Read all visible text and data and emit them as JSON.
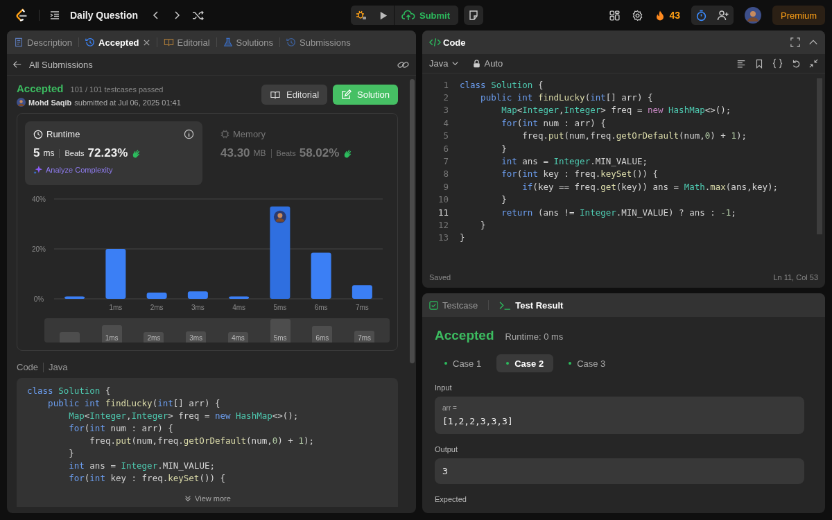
{
  "topbar": {
    "title": "Daily Question",
    "submit": "Submit",
    "streak": "43",
    "premium": "Premium"
  },
  "left_tabs": [
    {
      "label": "Description",
      "selected": false,
      "closable": false
    },
    {
      "label": "Accepted",
      "selected": true,
      "closable": true
    },
    {
      "label": "Editorial",
      "selected": false,
      "closable": false
    },
    {
      "label": "Solutions",
      "selected": false,
      "closable": false
    },
    {
      "label": "Submissions",
      "selected": false,
      "closable": false
    }
  ],
  "back_link": "All Submissions",
  "submission": {
    "status": "Accepted",
    "passed": "101 / 101 testcases passed",
    "user": "Mohd Saqib",
    "submitted": "submitted at Jul 06, 2025 01:41",
    "buttons": [
      {
        "label": "Editorial",
        "kind": "secondary"
      },
      {
        "label": "Solution",
        "kind": "primary"
      }
    ]
  },
  "stats": [
    {
      "title": "Runtime",
      "value": "5",
      "unit": "ms",
      "beats_label": "Beats",
      "beats": "72.23%",
      "selected": true,
      "link": "Analyze Complexity"
    },
    {
      "title": "Memory",
      "value": "43.30",
      "unit": "MB",
      "beats_label": "Beats",
      "beats": "58.02%",
      "selected": false
    }
  ],
  "chart_data": {
    "type": "bar",
    "categories": [
      null,
      "1ms",
      "2ms",
      "3ms",
      "4ms",
      "5ms",
      "6ms",
      "7ms"
    ],
    "values": [
      1,
      20,
      2.5,
      3,
      1,
      37,
      18.5,
      5.5
    ],
    "ylim": [
      0,
      40
    ],
    "yticks": [
      {
        "value": 0,
        "label": "0%"
      },
      {
        "value": 20,
        "label": "20%"
      },
      {
        "value": 40,
        "label": "40%"
      }
    ]
  },
  "chart_bars": [
    {
      "selected": false
    },
    {
      "selected": false
    },
    {
      "selected": false
    },
    {
      "selected": false
    },
    {
      "selected": false
    },
    {
      "selected": true
    },
    {
      "selected": false
    },
    {
      "selected": false
    }
  ],
  "range_selector": {
    "labels": [
      "1ms",
      "2ms",
      "3ms",
      "4ms",
      "5ms",
      "6ms",
      "7ms"
    ]
  },
  "code_section": {
    "label": "Code",
    "language": "Java",
    "view_more": "View more",
    "lines": [
      [
        {
          "kind": "kw",
          "text": "class"
        },
        {
          "kind": "type",
          "text": " Solution"
        },
        {
          "kind": "p",
          "text": " {"
        }
      ],
      [
        {
          "kind": "kw",
          "text": "    public int"
        },
        {
          "kind": "fn",
          "text": " findLucky"
        },
        {
          "kind": "p",
          "text": "("
        },
        {
          "kind": "kw",
          "text": "int"
        },
        {
          "kind": "p",
          "text": "[] arr) {"
        }
      ],
      [
        {
          "kind": "type",
          "text": "        Map"
        },
        {
          "kind": "p",
          "text": "<"
        },
        {
          "kind": "type",
          "text": "Integer"
        },
        {
          "kind": "p",
          "text": ","
        },
        {
          "kind": "type",
          "text": "Integer"
        },
        {
          "kind": "p",
          "text": "> freq = "
        },
        {
          "kind": "kw",
          "text": "new"
        },
        {
          "kind": "type",
          "text": " HashMap"
        },
        {
          "kind": "p",
          "text": "<>();"
        }
      ],
      [
        {
          "kind": "kw",
          "text": "        for"
        },
        {
          "kind": "p",
          "text": "("
        },
        {
          "kind": "kw",
          "text": "int"
        },
        {
          "kind": "p",
          "text": " num : arr) {"
        }
      ],
      [
        {
          "kind": "p",
          "text": "            freq."
        },
        {
          "kind": "fn",
          "text": "put"
        },
        {
          "kind": "p",
          "text": "(num,freq."
        },
        {
          "kind": "fn",
          "text": "getOrDefault"
        },
        {
          "kind": "p",
          "text": "(num,"
        },
        {
          "kind": "num",
          "text": "0"
        },
        {
          "kind": "p",
          "text": ") + "
        },
        {
          "kind": "num",
          "text": "1"
        },
        {
          "kind": "p",
          "text": ");"
        }
      ],
      [
        {
          "kind": "p",
          "text": "        }"
        }
      ],
      [
        {
          "kind": "kw",
          "text": "        int"
        },
        {
          "kind": "p",
          "text": " ans = "
        },
        {
          "kind": "type",
          "text": "Integer"
        },
        {
          "kind": "p",
          "text": ".MIN_VALUE;"
        }
      ],
      [
        {
          "kind": "kw",
          "text": "        for"
        },
        {
          "kind": "p",
          "text": "("
        },
        {
          "kind": "kw",
          "text": "int"
        },
        {
          "kind": "p",
          "text": " key : freq."
        },
        {
          "kind": "fn",
          "text": "keySet"
        },
        {
          "kind": "p",
          "text": "()) {"
        }
      ]
    ]
  },
  "editor": {
    "title": "Code",
    "language": "Java",
    "mode": "Auto",
    "status": "Saved",
    "cursor": "Ln 11, Col 53",
    "lines": [
      {
        "n": "1",
        "selected": false,
        "tokens": [
          {
            "kind": "kw",
            "text": "class"
          },
          {
            "kind": "type",
            "text": " Solution"
          },
          {
            "kind": "p",
            "text": " {"
          }
        ]
      },
      {
        "n": "2",
        "selected": false,
        "tokens": [
          {
            "kind": "kw",
            "text": "    public int"
          },
          {
            "kind": "fn",
            "text": " findLucky"
          },
          {
            "kind": "p",
            "text": "("
          },
          {
            "kind": "kw",
            "text": "int"
          },
          {
            "kind": "p",
            "text": "[] arr) {"
          }
        ]
      },
      {
        "n": "3",
        "selected": false,
        "tokens": [
          {
            "kind": "type",
            "text": "        Map"
          },
          {
            "kind": "p",
            "text": "<"
          },
          {
            "kind": "type",
            "text": "Integer"
          },
          {
            "kind": "p",
            "text": ","
          },
          {
            "kind": "type",
            "text": "Integer"
          },
          {
            "kind": "p",
            "text": "> freq = "
          },
          {
            "kind": "op",
            "text": "new"
          },
          {
            "kind": "type",
            "text": " HashMap"
          },
          {
            "kind": "p",
            "text": "<>();"
          }
        ]
      },
      {
        "n": "4",
        "selected": false,
        "tokens": [
          {
            "kind": "kw",
            "text": "        for"
          },
          {
            "kind": "p",
            "text": "("
          },
          {
            "kind": "kw",
            "text": "int"
          },
          {
            "kind": "p",
            "text": " num : arr) {"
          }
        ]
      },
      {
        "n": "5",
        "selected": false,
        "tokens": [
          {
            "kind": "p",
            "text": "            freq."
          },
          {
            "kind": "fn",
            "text": "put"
          },
          {
            "kind": "p",
            "text": "(num,freq."
          },
          {
            "kind": "fn",
            "text": "getOrDefault"
          },
          {
            "kind": "p",
            "text": "(num,"
          },
          {
            "kind": "num",
            "text": "0"
          },
          {
            "kind": "p",
            "text": ") + "
          },
          {
            "kind": "num",
            "text": "1"
          },
          {
            "kind": "p",
            "text": ");"
          }
        ]
      },
      {
        "n": "6",
        "selected": false,
        "tokens": [
          {
            "kind": "p",
            "text": "        }"
          }
        ]
      },
      {
        "n": "7",
        "selected": false,
        "tokens": [
          {
            "kind": "kw",
            "text": "        int"
          },
          {
            "kind": "p",
            "text": " ans = "
          },
          {
            "kind": "type",
            "text": "Integer"
          },
          {
            "kind": "p",
            "text": ".MIN_VALUE;"
          }
        ]
      },
      {
        "n": "8",
        "selected": false,
        "tokens": [
          {
            "kind": "kw",
            "text": "        for"
          },
          {
            "kind": "p",
            "text": "("
          },
          {
            "kind": "kw",
            "text": "int"
          },
          {
            "kind": "p",
            "text": " key : freq."
          },
          {
            "kind": "fn",
            "text": "keySet"
          },
          {
            "kind": "p",
            "text": "()) {"
          }
        ]
      },
      {
        "n": "9",
        "selected": false,
        "tokens": [
          {
            "kind": "kw",
            "text": "            if"
          },
          {
            "kind": "p",
            "text": "(key == freq."
          },
          {
            "kind": "fn",
            "text": "get"
          },
          {
            "kind": "p",
            "text": "(key)) ans = "
          },
          {
            "kind": "type",
            "text": "Math"
          },
          {
            "kind": "p",
            "text": "."
          },
          {
            "kind": "fn",
            "text": "max"
          },
          {
            "kind": "p",
            "text": "(ans,key);"
          }
        ]
      },
      {
        "n": "10",
        "selected": false,
        "tokens": [
          {
            "kind": "p",
            "text": "        }"
          }
        ]
      },
      {
        "n": "11",
        "selected": true,
        "tokens": [
          {
            "kind": "kw",
            "text": "        return"
          },
          {
            "kind": "p",
            "text": " (ans != "
          },
          {
            "kind": "type",
            "text": "Integer"
          },
          {
            "kind": "p",
            "text": ".MIN_VALUE) ? ans : "
          },
          {
            "kind": "num",
            "text": "-1"
          },
          {
            "kind": "p",
            "text": ";"
          }
        ]
      },
      {
        "n": "12",
        "selected": false,
        "tokens": [
          {
            "kind": "p",
            "text": "    }"
          }
        ]
      },
      {
        "n": "13",
        "selected": false,
        "tokens": [
          {
            "kind": "p",
            "text": "}"
          }
        ]
      }
    ]
  },
  "test_panel": {
    "tabs": [
      {
        "label": "Testcase",
        "selected": false
      },
      {
        "label": "Test Result",
        "selected": true
      }
    ],
    "status": "Accepted",
    "runtime": "Runtime: 0 ms",
    "cases": [
      {
        "label": "Case 1",
        "selected": false
      },
      {
        "label": "Case 2",
        "selected": true
      },
      {
        "label": "Case 3",
        "selected": false
      }
    ],
    "input_label": "Input",
    "inputs": [
      {
        "name": "arr =",
        "value": "[1,2,2,3,3,3]"
      }
    ],
    "output_label": "Output",
    "output": "3",
    "expected_label": "Expected"
  }
}
